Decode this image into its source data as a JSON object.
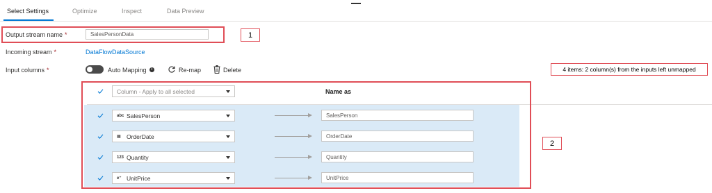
{
  "tabs": [
    {
      "label": "Select Settings"
    },
    {
      "label": "Optimize"
    },
    {
      "label": "Inspect"
    },
    {
      "label": "Data Preview"
    }
  ],
  "form": {
    "output_stream": {
      "label": "Output stream name",
      "required": "*",
      "value": "SalesPersonData"
    },
    "incoming_stream": {
      "label": "Incoming stream",
      "required": "*",
      "value": "DataFlowDataSource"
    },
    "input_columns": {
      "label": "Input columns",
      "required": "*"
    }
  },
  "toolbar": {
    "auto_mapping_label": "Auto Mapping",
    "auto_mapping_on": false,
    "info_glyph": "i",
    "remap_label": "Re-map",
    "delete_label": "Delete"
  },
  "mapping_status": "4 items: 2 column(s) from the inputs left unmapped",
  "mapping_header": {
    "column_placeholder": "Column - Apply to all selected",
    "name_as_label": "Name as"
  },
  "mappings": [
    {
      "type_badge": "abc",
      "type_icon": "string-type-icon",
      "column": "SalesPerson",
      "name_as": "SalesPerson",
      "checked": true
    },
    {
      "type_badge": "▦",
      "type_icon": "date-type-icon",
      "column": "OrderDate",
      "name_as": "OrderDate",
      "checked": true
    },
    {
      "type_badge": "123",
      "type_icon": "integer-type-icon",
      "column": "Quantity",
      "name_as": "Quantity",
      "checked": true
    },
    {
      "type_badge": "e⁺",
      "type_icon": "decimal-type-icon",
      "column": "UnitPrice",
      "name_as": "UnitPrice",
      "checked": true
    }
  ],
  "callouts": {
    "one": "1",
    "two": "2"
  },
  "colors": {
    "accent": "#0078d4",
    "annotation_red": "#e04d56",
    "mapping_bg": "#daeaf7",
    "required": "#a4262c"
  }
}
